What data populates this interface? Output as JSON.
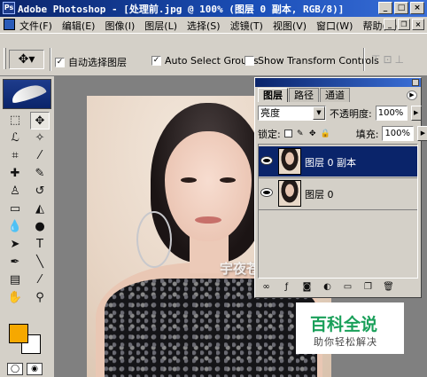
{
  "window": {
    "title": "Adobe Photoshop - [处理前.jpg @ 100% (图层 0 副本, RGB/8)]",
    "icon_text": "Ps",
    "buttons": {
      "minimize": "_",
      "maximize": "□",
      "close": "×"
    }
  },
  "menu": {
    "items": [
      "文件(F)",
      "编辑(E)",
      "图像(I)",
      "图层(L)",
      "选择(S)",
      "滤镜(T)",
      "视图(V)",
      "窗口(W)",
      "帮助(H)"
    ],
    "doc_buttons": {
      "minimize": "_",
      "restore": "❐",
      "close": "×"
    }
  },
  "options_bar": {
    "tool_icon": "move-tool-icon",
    "auto_select_layer": {
      "label": "自动选择图层",
      "checked": true,
      "mark": "✓"
    },
    "auto_select_groups": {
      "label": "Auto Select Groups",
      "checked": true,
      "mark": "✓"
    },
    "show_transform": {
      "label": "Show Transform Controls",
      "checked": false,
      "mark": ""
    }
  },
  "toolbox": {
    "tools": [
      {
        "name": "marquee",
        "glyph": "⬚"
      },
      {
        "name": "move",
        "glyph": "✥"
      },
      {
        "name": "lasso",
        "glyph": "ℒ"
      },
      {
        "name": "magic-wand",
        "glyph": "✧"
      },
      {
        "name": "crop",
        "glyph": "⌗"
      },
      {
        "name": "slice",
        "glyph": "⁄"
      },
      {
        "name": "healing",
        "glyph": "✚"
      },
      {
        "name": "brush",
        "glyph": "✎"
      },
      {
        "name": "stamp",
        "glyph": "♙"
      },
      {
        "name": "history-brush",
        "glyph": "↺"
      },
      {
        "name": "eraser",
        "glyph": "▭"
      },
      {
        "name": "paint-bucket",
        "glyph": "◭"
      },
      {
        "name": "blur",
        "glyph": "💧"
      },
      {
        "name": "dodge",
        "glyph": "●"
      },
      {
        "name": "path-select",
        "glyph": "➤"
      },
      {
        "name": "type",
        "glyph": "T"
      },
      {
        "name": "pen",
        "glyph": "✒"
      },
      {
        "name": "line",
        "glyph": "╲"
      },
      {
        "name": "notes",
        "glyph": "▤"
      },
      {
        "name": "eyedropper",
        "glyph": "⁄"
      },
      {
        "name": "hand",
        "glyph": "✋"
      },
      {
        "name": "zoom",
        "glyph": "⚲"
      }
    ],
    "foreground_color": "#f6a800",
    "background_color": "#ffffff"
  },
  "canvas": {
    "watermark": "宇夜苍穹出品"
  },
  "layers_panel": {
    "tabs": [
      "图层",
      "路径",
      "通道"
    ],
    "active_tab": "图层",
    "blend_mode": "亮度",
    "opacity_label": "不透明度:",
    "opacity_value": "100%",
    "lock_label": "锁定:",
    "fill_label": "填充:",
    "fill_value": "100%",
    "layers": [
      {
        "name": "图层 0 副本",
        "selected": true,
        "visible": true
      },
      {
        "name": "图层 0",
        "selected": false,
        "visible": true
      }
    ],
    "footer_icons": [
      "link-icon",
      "layer-style-icon",
      "mask-icon",
      "adjustment-icon",
      "folder-icon",
      "new-layer-icon",
      "trash-icon"
    ]
  },
  "badge": {
    "title": "百科全说",
    "subtitle": "助你轻松解决"
  },
  "colors": {
    "titlebar": "#0a246a",
    "selected_layer": "#0a246a",
    "badge_green": "#1aa05a"
  }
}
